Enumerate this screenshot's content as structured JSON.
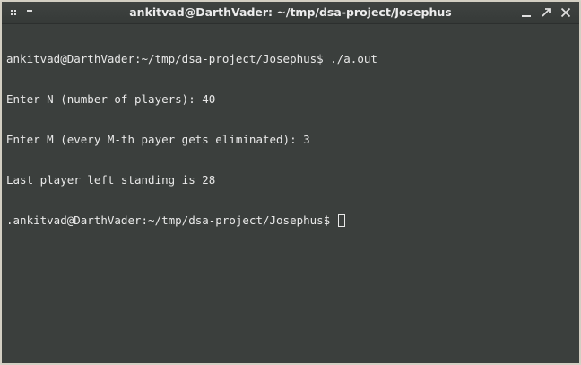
{
  "window": {
    "title": "ankitvad@DarthVader: ~/tmp/dsa-project/Josephus",
    "icons": [
      "grip-icon",
      "dash-icon",
      "minimize-icon",
      "maximize-icon",
      "close-icon"
    ],
    "colors": {
      "titlebar": "#3a3e3c",
      "terminal_bg": "#3b3f3d",
      "frame": "#d3cfc3",
      "text": "#e9e9e9"
    }
  },
  "terminal": {
    "lines": [
      "ankitvad@DarthVader:~/tmp/dsa-project/Josephus$ ./a.out",
      "Enter N (number of players): 40",
      "Enter M (every M-th payer gets eliminated): 3",
      "Last player left standing is 28"
    ],
    "prompt": ".ankitvad@DarthVader:~/tmp/dsa-project/Josephus$ "
  }
}
